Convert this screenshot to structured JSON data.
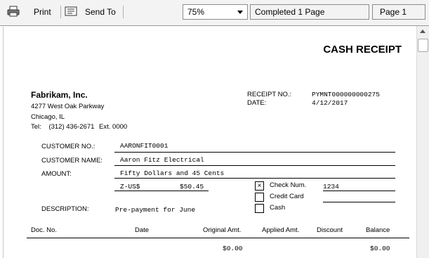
{
  "toolbar": {
    "print_label": "Print",
    "send_to_label": "Send To",
    "zoom_value": "75%",
    "status_text": "Completed 1 Page",
    "page_indicator": "Page 1"
  },
  "receipt": {
    "title": "CASH RECEIPT",
    "company": {
      "name": "Fabrikam, Inc.",
      "address1": "4277 West Oak Parkway",
      "address2": "Chicago, IL",
      "phone_label": "Tel:",
      "phone": "(312) 436-2671",
      "ext": "Ext. 0000"
    },
    "receipt_no_label": "RECEIPT NO.:",
    "receipt_no": "PYMNT000000000275",
    "date_label": "DATE:",
    "date": "4/12/2017",
    "customer_no_label": "CUSTOMER NO.:",
    "customer_no": "AARONFIT0001",
    "customer_name_label": "CUSTOMER NAME:",
    "customer_name": "Aaron Fitz Electrical",
    "amount_label": "AMOUNT:",
    "amount_words": "Fifty Dollars and 45 Cents",
    "currency": "Z-US$",
    "amount": "$50.45",
    "payment_methods": {
      "check_label": "Check Num.",
      "check_mark": "×",
      "check_number": "1234",
      "credit_card_label": "Credit Card",
      "cash_label": "Cash"
    },
    "description_label": "DESCRIPTION:",
    "description": "Pre-payment for June",
    "table": {
      "headers": [
        "Doc. No.",
        "Date",
        "Original Amt.",
        "Applied Amt.",
        "Discount",
        "Balance"
      ],
      "original_total": "$0.00",
      "balance_total": "$0.00"
    }
  }
}
